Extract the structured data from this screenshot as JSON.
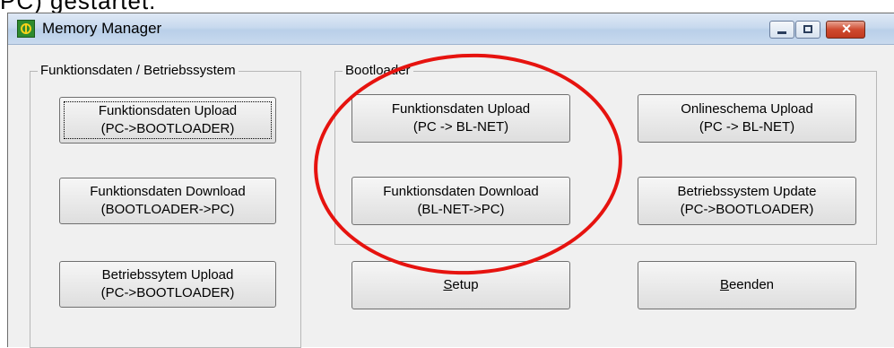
{
  "document": {
    "fragment_text": "PC) gestartet."
  },
  "window": {
    "title": "Memory Manager",
    "app_icon": "app-logo-icon",
    "controls": {
      "minimize": "minimize-icon",
      "maximize": "maximize-icon",
      "close": "×"
    }
  },
  "groups": {
    "funktionsdaten": {
      "label": "Funktionsdaten / Betriebssystem",
      "buttons": [
        {
          "line1": "Funktionsdaten Upload",
          "line2": "(PC->BOOTLOADER)"
        },
        {
          "line1": "Funktionsdaten Download",
          "line2": "(BOOTLOADER->PC)"
        },
        {
          "line1": "Betriebssytem Upload",
          "line2": "(PC->BOOTLOADER)"
        }
      ]
    },
    "bootloader": {
      "label": "Bootloader",
      "buttons": [
        {
          "line1": "Funktionsdaten Upload",
          "line2": "(PC -> BL-NET)"
        },
        {
          "line1": "Onlineschema Upload",
          "line2": "(PC -> BL-NET)"
        },
        {
          "line1": "Funktionsdaten Download",
          "line2": "(BL-NET->PC)"
        },
        {
          "line1": "Betriebssystem Update",
          "line2": "(PC->BOOTLOADER)"
        }
      ]
    }
  },
  "bottom_buttons": {
    "setup": "Setup",
    "beenden": "Beenden"
  },
  "annotation": {
    "color": "#e6130f"
  }
}
